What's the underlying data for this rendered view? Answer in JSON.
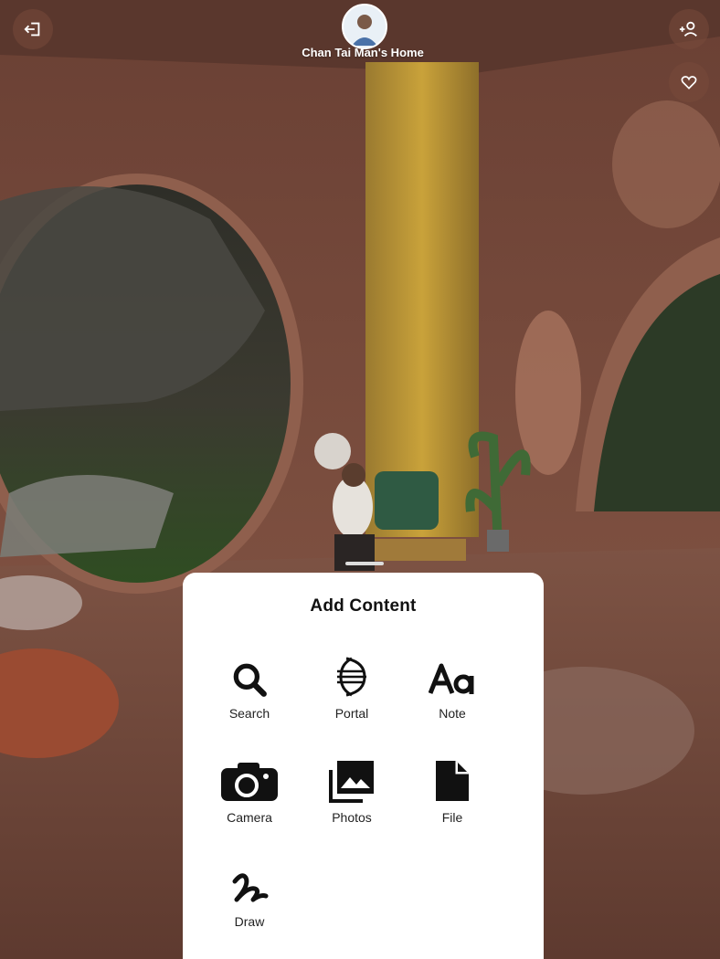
{
  "header": {
    "home_title": "Chan Tai Man's Home",
    "exit_icon": "exit-icon",
    "invite_icon": "add-person-icon",
    "favorite_icon": "heart-icon"
  },
  "add_content": {
    "title": "Add Content",
    "options": [
      {
        "label": "Search",
        "icon": "search-icon"
      },
      {
        "label": "Portal",
        "icon": "portal-icon"
      },
      {
        "label": "Note",
        "icon": "text-aa-icon"
      },
      {
        "label": "Camera",
        "icon": "camera-icon"
      },
      {
        "label": "Photos",
        "icon": "photos-icon"
      },
      {
        "label": "File",
        "icon": "file-icon"
      },
      {
        "label": "Draw",
        "icon": "draw-squiggle-icon"
      }
    ]
  },
  "colors": {
    "wall": "#7a4c3e",
    "sheet": "#ffffff",
    "accent_curtain": "#c9a23a"
  }
}
